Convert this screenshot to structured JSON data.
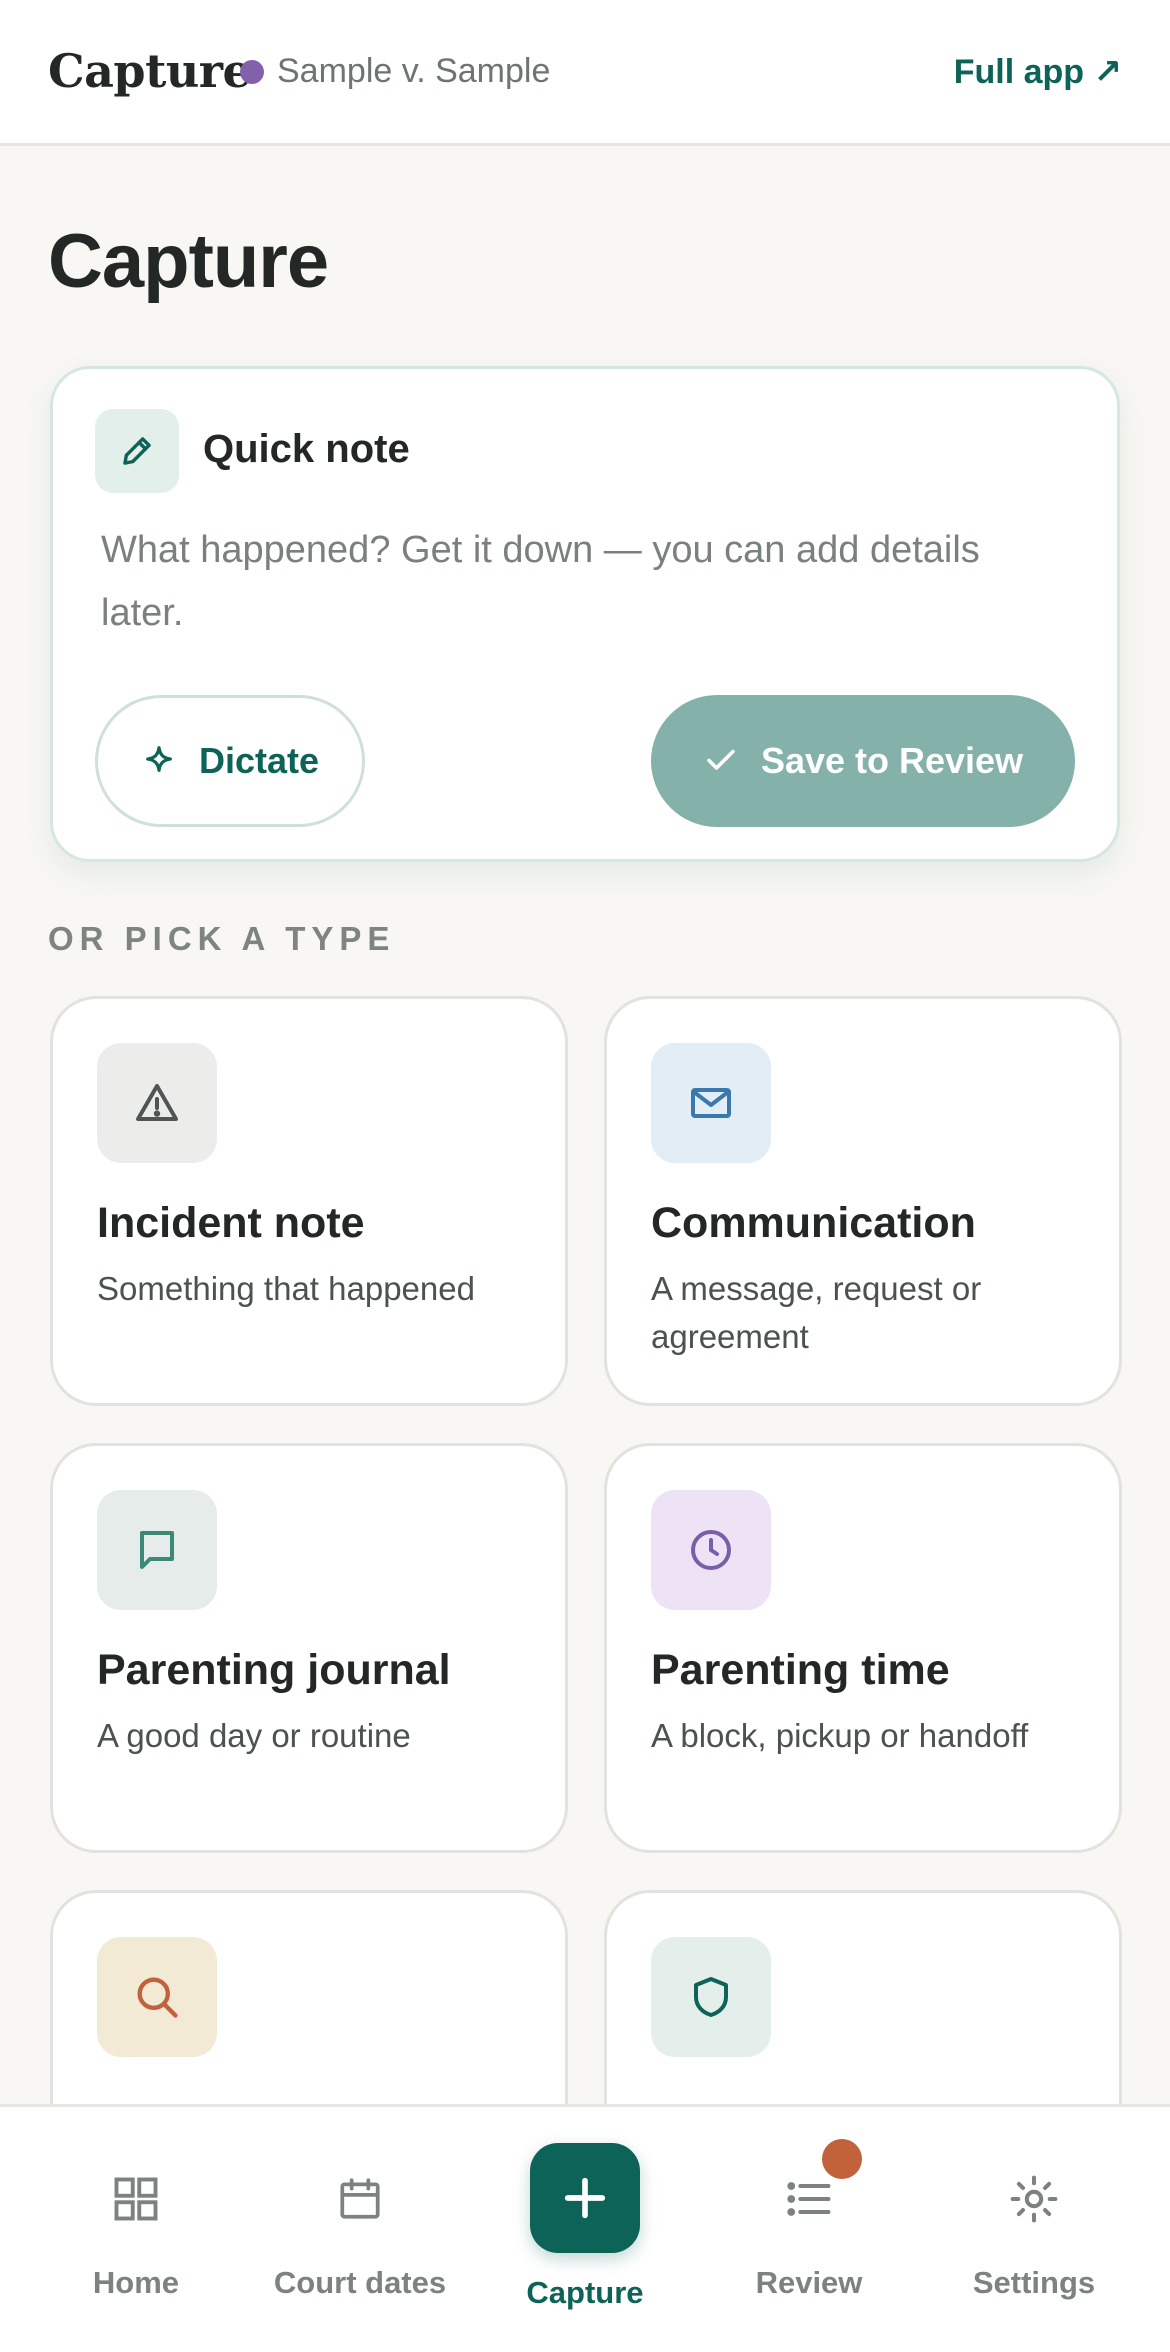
{
  "header": {
    "brand": "Capture",
    "case_name": "Sample v. Sample",
    "case_color": "#8361aa",
    "full_app_label": "Full app ↗"
  },
  "page_title": "Capture",
  "quick_note": {
    "icon": "pencil-icon",
    "title": "Quick note",
    "placeholder": "What happened? Get it down — you can add details later.",
    "dictate_label": "Dictate",
    "dictate_icon": "sparkle-icon",
    "save_label": "Save to Review",
    "save_icon": "check-icon"
  },
  "section_label": "OR PICK A TYPE",
  "types": [
    {
      "title": "Incident note",
      "subtitle": "Something that happened",
      "icon": "warning-icon",
      "icon_bg": "#ecedeb",
      "icon_color": "#4e5552"
    },
    {
      "title": "Communication",
      "subtitle": "A message, request or agreement",
      "icon": "envelope-icon",
      "icon_bg": "#e2edf5",
      "icon_color": "#3a79ad"
    },
    {
      "title": "Parenting journal",
      "subtitle": "A good day or routine",
      "icon": "journal-icon",
      "icon_bg": "#e6ecea",
      "icon_color": "#3a8a76"
    },
    {
      "title": "Parenting time",
      "subtitle": "A block, pickup or handoff",
      "icon": "clock-icon",
      "icon_bg": "#ede3f5",
      "icon_color": "#7a5ea8"
    },
    {
      "title": "",
      "subtitle": "",
      "icon": "search-icon",
      "icon_bg": "#f3ead6",
      "icon_color": "#c0623a"
    },
    {
      "title": "",
      "subtitle": "",
      "icon": "shield-icon",
      "icon_bg": "#e4efeb",
      "icon_color": "#0d6357"
    }
  ],
  "nav": {
    "items": [
      {
        "label": "Home",
        "icon": "grid-icon"
      },
      {
        "label": "Court dates",
        "icon": "calendar-icon"
      },
      {
        "label": "Capture",
        "icon": "plus-icon",
        "active": true
      },
      {
        "label": "Review",
        "icon": "list-icon",
        "badge": true
      },
      {
        "label": "Settings",
        "icon": "gear-icon"
      }
    ],
    "accent": "#0d6357",
    "badge_color": "#c2623a"
  }
}
